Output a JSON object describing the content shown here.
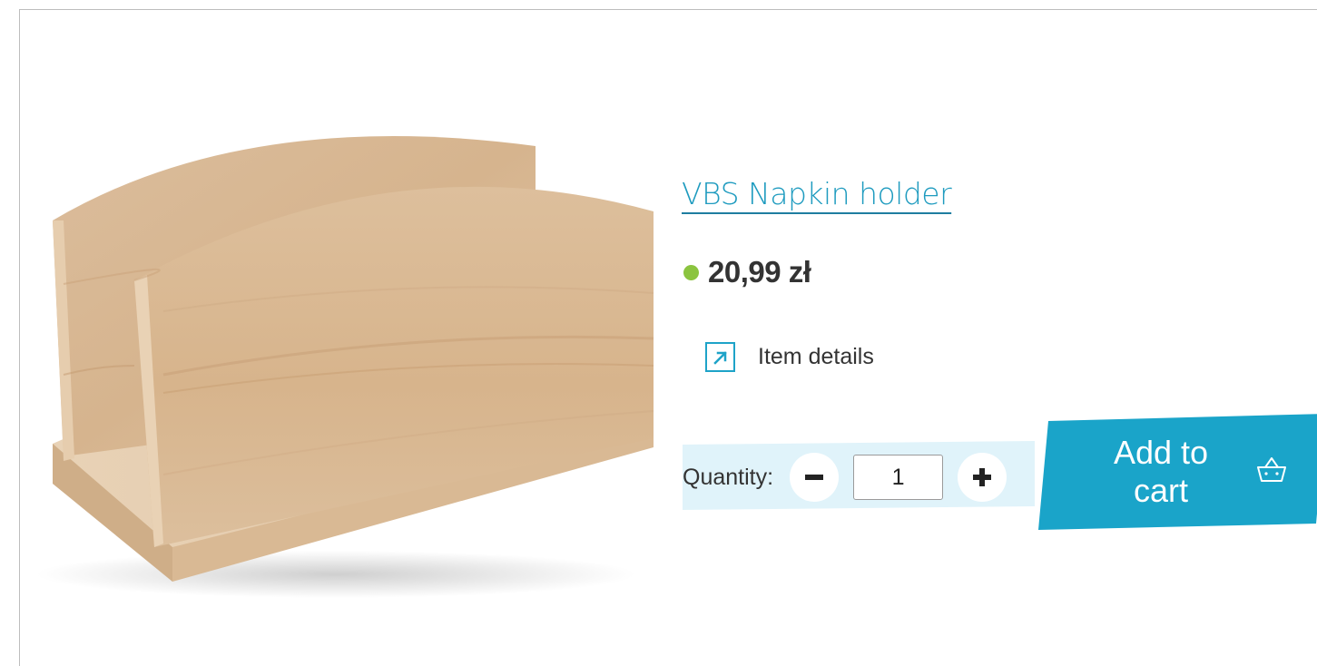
{
  "product": {
    "title": "VBS Napkin holder",
    "price": "20,99 zł",
    "image_alt": "Wooden napkin holder",
    "details_label": "Item details"
  },
  "quantity": {
    "label": "Quantity:",
    "value": "1"
  },
  "cart": {
    "label_line1": "Add to",
    "label_line2": "cart"
  },
  "colors": {
    "accent": "#1aa4c9",
    "title": "#1e9bbf",
    "in_stock": "#8bc43f",
    "qty_strip": "#e0f3fa"
  },
  "icons": {
    "details": "external-link-icon",
    "minus": "minus-icon",
    "plus": "plus-icon",
    "cart": "basket-icon"
  }
}
